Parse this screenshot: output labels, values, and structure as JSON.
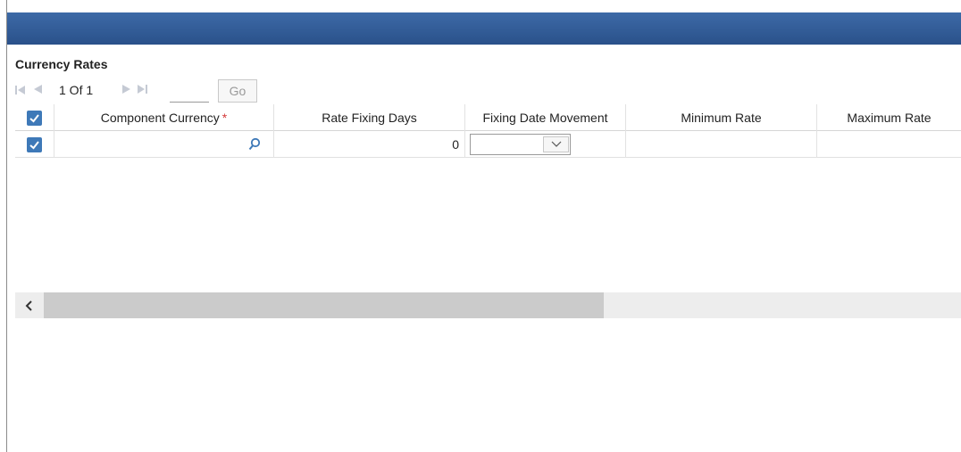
{
  "window": {
    "title": ""
  },
  "section": {
    "title": "Currency Rates"
  },
  "pager": {
    "page_text": "1 Of 1",
    "page_input_value": "",
    "go_label": "Go"
  },
  "table": {
    "columns": [
      {
        "label": "Component Currency",
        "required": true,
        "required_mark": "*"
      },
      {
        "label": "Rate Fixing Days"
      },
      {
        "label": "Fixing Date Movement"
      },
      {
        "label": "Minimum Rate"
      },
      {
        "label": "Maximum Rate"
      }
    ],
    "header_checked": true,
    "rows": [
      {
        "checked": true,
        "component_currency": "",
        "rate_fixing_days": "0",
        "fixing_date_movement": "",
        "minimum_rate": "",
        "maximum_rate": ""
      }
    ]
  },
  "scrollbar": {
    "left_arrow_icon": "chevron-left-icon"
  },
  "icons": {
    "checkbox": "checkbox-checked-icon",
    "lookup": "search-icon",
    "dropdown": "chevron-down-icon"
  },
  "colors": {
    "title_bar": "#2f5a96",
    "checkbox": "#3e79b8",
    "required": "#d43a3a",
    "nav_disabled": "#c5cad4"
  }
}
